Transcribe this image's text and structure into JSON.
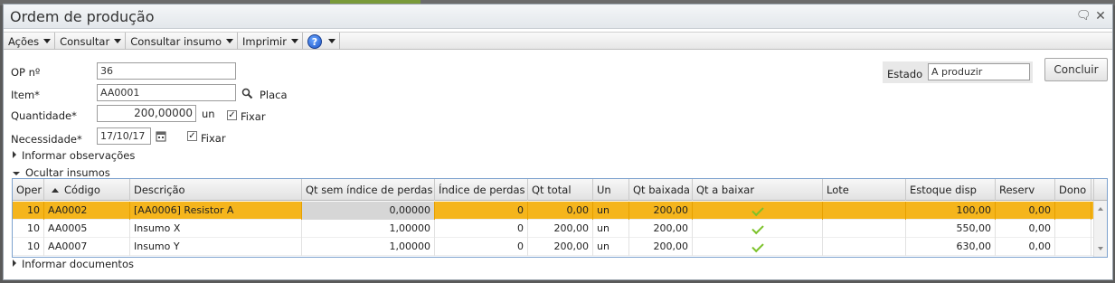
{
  "window": {
    "title": "Ordem de produção"
  },
  "toolbar": {
    "items": [
      {
        "label": "Ações"
      },
      {
        "label": "Consultar"
      },
      {
        "label": "Consultar insumo"
      },
      {
        "label": "Imprimir"
      }
    ],
    "help_icon": "question-icon"
  },
  "form": {
    "op_label": "OP nº",
    "op_value": "36",
    "item_label": "Item*",
    "item_value": "AA0001",
    "item_desc": "Placa",
    "quantidade_label": "Quantidade*",
    "quantidade_value": "200,00000",
    "quantidade_unit": "un",
    "quantidade_fixar": "Fixar",
    "necessidade_label": "Necessidade*",
    "necessidade_value": "17/10/17",
    "necessidade_fixar": "Fixar",
    "estado_label": "Estado",
    "estado_value": "A produzir",
    "concluir_label": "Concluir",
    "informar_observacoes": "Informar observações",
    "ocultar_insumos": "Ocultar insumos",
    "informar_documentos": "Informar documentos"
  },
  "grid": {
    "columns": [
      "Oper",
      "Código",
      "Descrição",
      "Qt sem índice de perdas",
      "Índice de perdas",
      "Qt total",
      "Un",
      "Qt baixada",
      "Qt a baixar",
      "Lote",
      "Estoque disp",
      "Reserv",
      "Dono"
    ],
    "rows": [
      {
        "oper": "10",
        "codigo": "AA0002",
        "descricao": "[AA0006] Resistor A",
        "qt_sem": "0,00000",
        "indice": "0",
        "qt_total": "0,00",
        "un": "un",
        "qt_baixada": "200,00",
        "qt_a_baixar": true,
        "lote": "",
        "estoque": "100,00",
        "reserv": "0,00",
        "dono": ""
      },
      {
        "oper": "10",
        "codigo": "AA0005",
        "descricao": "Insumo X",
        "qt_sem": "1,00000",
        "indice": "0",
        "qt_total": "200,00",
        "un": "un",
        "qt_baixada": "200,00",
        "qt_a_baixar": true,
        "lote": "",
        "estoque": "550,00",
        "reserv": "0,00",
        "dono": ""
      },
      {
        "oper": "10",
        "codigo": "AA0007",
        "descricao": "Insumo Y",
        "qt_sem": "1,00000",
        "indice": "0",
        "qt_total": "200,00",
        "un": "un",
        "qt_baixada": "200,00",
        "qt_a_baixar": true,
        "lote": "",
        "estoque": "630,00",
        "reserv": "0,00",
        "dono": ""
      }
    ],
    "selected_row_color": "#f5b51c"
  }
}
